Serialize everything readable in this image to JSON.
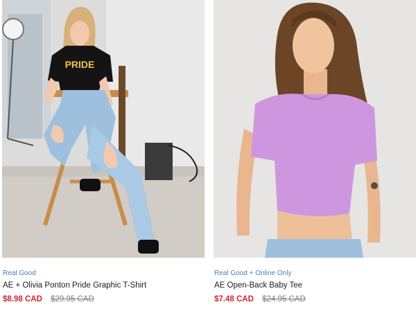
{
  "products": [
    {
      "badge": "Real Good",
      "title": "AE + Olivia Ponton Pride Graphic T-Shirt",
      "sale_price": "$8.98 CAD",
      "original_price": "$29.95 CAD",
      "shirt_print": "PRIDE"
    },
    {
      "badge": "Real Good + Online Only",
      "title": "AE Open-Back Baby Tee",
      "sale_price": "$7.48 CAD",
      "original_price": "$24.95 CAD"
    }
  ],
  "colors": {
    "badge": "#4a7fb5",
    "sale_price": "#d0262f",
    "original_price": "#7c7c7c"
  }
}
